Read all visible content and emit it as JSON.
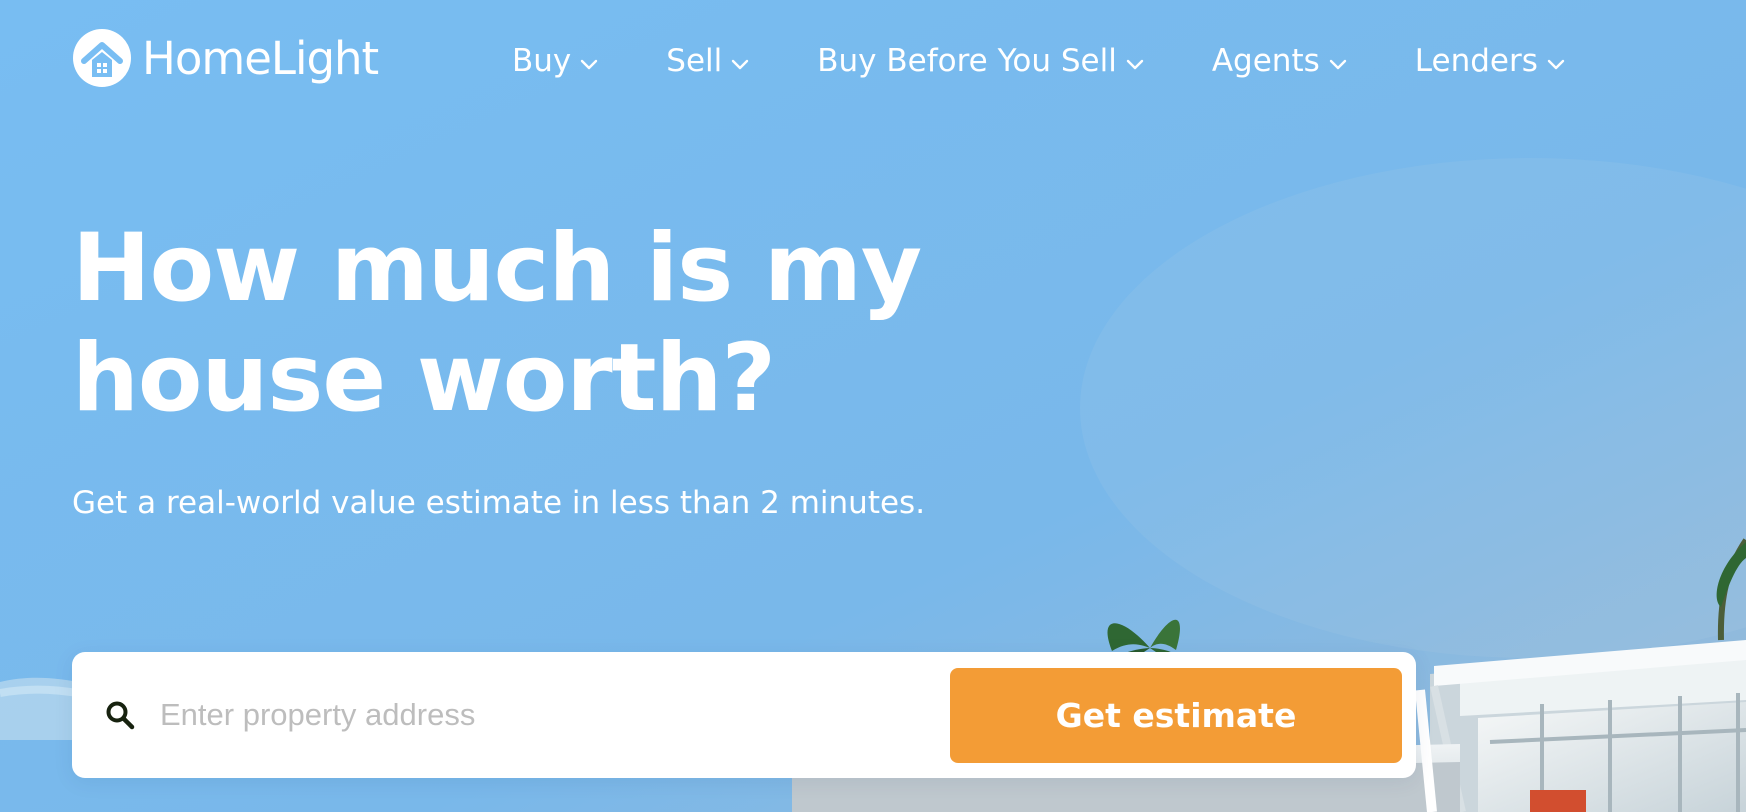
{
  "brand": {
    "name": "HomeLight",
    "colors": {
      "sky": "#79bef3",
      "white": "#ffffff",
      "accent": "#f39c36",
      "placeholder": "#bdbdbd"
    },
    "logo_icon": "house-in-circle-icon"
  },
  "nav": {
    "items": [
      {
        "label": "Buy",
        "icon": "chevron-down-icon"
      },
      {
        "label": "Sell",
        "icon": "chevron-down-icon"
      },
      {
        "label": "Buy Before You Sell",
        "icon": "chevron-down-icon"
      },
      {
        "label": "Agents",
        "icon": "chevron-down-icon"
      },
      {
        "label": "Lenders",
        "icon": "chevron-down-icon"
      }
    ]
  },
  "hero": {
    "title_line1": "How much is my",
    "title_line2": "house worth?",
    "subtitle": "Get a real-world value estimate in less than 2 minutes."
  },
  "search": {
    "icon": "search-icon",
    "placeholder": "Enter property address",
    "value": "",
    "button_label": "Get estimate"
  }
}
